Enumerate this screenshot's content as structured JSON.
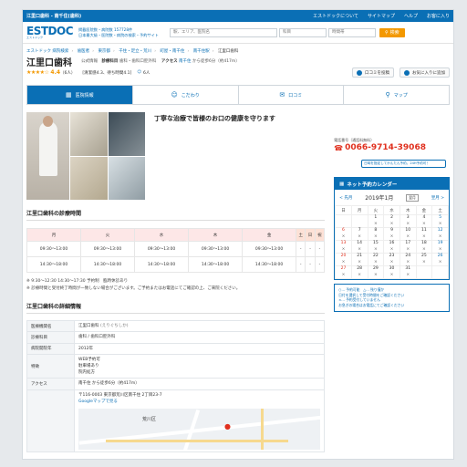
{
  "topbar": {
    "title": "江里口歯科 - 南千住(歯科)",
    "links": [
      "エストドックについて",
      "サイトマップ",
      "ヘルプ",
      "お客に入り"
    ]
  },
  "header": {
    "logo": "ESTDOC",
    "logo_sub": "エストドック",
    "tagline1": "掲載医院数・病院数 157728件",
    "tagline2": "日本最大級・医院数・病院の検索・予約サイト",
    "search_placeholder": "駅、エリア、医院名",
    "search_dept": "科目",
    "search_time": "時間帯",
    "search_button": "検索"
  },
  "breadcrumbs": [
    "エストドック 病院検索",
    "歯医者",
    "東京都",
    "千住・足立・荒川",
    "町屋・南千住",
    "南千住駅",
    "江里口歯科"
  ],
  "clinic": {
    "name": "江里口歯科",
    "info_label": "公式情報",
    "dept_label": "診療科目",
    "depts": "歯科・歯科口腔外科",
    "access_label": "アクセス",
    "access": "南千住",
    "access_walk": "から徒歩6分（約417m）",
    "rating_stars": "★★★★☆",
    "rating": "4.4",
    "rating_count": "（6人）",
    "rating_detail": "[清潔感4.3、待ち時間4.1]",
    "likes": "6人",
    "btn_review": "口コミを投稿",
    "btn_fav": "お気に入りに追加"
  },
  "tabs": [
    {
      "label": "医院情報",
      "icon": "▦"
    },
    {
      "label": "こだわり",
      "icon": "☺"
    },
    {
      "label": "口コミ",
      "icon": "✉"
    },
    {
      "label": "マップ",
      "icon": "⚲"
    }
  ],
  "catch": "丁寧な治療で皆様のお口の健康を守ります",
  "hours": {
    "heading": "江里口歯科の診療時間",
    "days": [
      "月",
      "火",
      "水",
      "木",
      "金",
      "土",
      "日",
      "祝"
    ],
    "rows": [
      [
        "09:30〜13:00",
        "09:30〜13:00",
        "09:30〜13:00",
        "09:30〜13:00",
        "09:30〜13:00",
        "-",
        "-",
        "-"
      ],
      [
        "14:30〜18:00",
        "14:30〜18:00",
        "14:30〜18:00",
        "14:30〜18:00",
        "14:30〜18:00",
        "-",
        "-",
        "-"
      ]
    ],
    "note1": "※ 9:30〜12:30 14:30〜17:30 予約制　臨時休診あり",
    "note2": "※ 診療時間と受付終了時間が一致しない場合がございます。ご予約またはお電話にてご確認の上、ご来院ください。"
  },
  "detail": {
    "heading": "江里口歯科の詳細情報",
    "rows": [
      {
        "k": "医療機関名",
        "v": "江里口歯科",
        "sub": "(えりぐちしか)"
      },
      {
        "k": "診療科目",
        "v": "歯科 / 歯科口腔外科",
        "sub": ""
      },
      {
        "k": "病院開院年",
        "v": "2012年",
        "sub": ""
      },
      {
        "k": "特徴",
        "v": "WEB予約可\n駐車場あり\n院内処方",
        "sub": ""
      },
      {
        "k": "アクセス",
        "v": "南千住 から徒歩6分（約417m）",
        "sub": ""
      }
    ],
    "address": "〒116-0003 東京都荒川区南千住 2丁目23-7",
    "map_link": "Googleマップで見る",
    "map_label": "荒川区"
  },
  "sidebar": {
    "phone_label": "電話番号（通話料無料）",
    "phone": "0066-9714-39068",
    "cal_note": "日時を指定してかんたん予約。24H予約可！",
    "cal_title": "ネット予約カレンダー",
    "prev": "< 先月",
    "month": "2019年1月",
    "next": "翌月 >",
    "month_select": "翌月",
    "weekdays": [
      "日",
      "月",
      "火",
      "水",
      "木",
      "金",
      "土"
    ],
    "weeks": [
      [
        [
          "",
          ""
        ],
        [
          "",
          ""
        ],
        [
          "1",
          "×"
        ],
        [
          "2",
          "×"
        ],
        [
          "3",
          "×"
        ],
        [
          "4",
          "×"
        ],
        [
          "5",
          "×"
        ]
      ],
      [
        [
          "6",
          "×"
        ],
        [
          "7",
          "×"
        ],
        [
          "8",
          "×"
        ],
        [
          "9",
          "×"
        ],
        [
          "10",
          "×"
        ],
        [
          "11",
          "×"
        ],
        [
          "12",
          "×"
        ]
      ],
      [
        [
          "13",
          "×"
        ],
        [
          "14",
          "×"
        ],
        [
          "15",
          "×"
        ],
        [
          "16",
          "×"
        ],
        [
          "17",
          "×"
        ],
        [
          "18",
          "×"
        ],
        [
          "19",
          "×"
        ]
      ],
      [
        [
          "20",
          "×"
        ],
        [
          "21",
          "×"
        ],
        [
          "22",
          "×"
        ],
        [
          "23",
          "×"
        ],
        [
          "24",
          "×"
        ],
        [
          "25",
          "×"
        ],
        [
          "26",
          "×"
        ]
      ],
      [
        [
          "27",
          "×"
        ],
        [
          "28",
          "×"
        ],
        [
          "29",
          "×"
        ],
        [
          "30",
          "×"
        ],
        [
          "31",
          "×"
        ],
        [
          "",
          ""
        ],
        [
          "",
          ""
        ]
      ]
    ],
    "cal_foot1": "○... 予約可能　△... 残り僅か",
    "cal_foot2": "日付を選択して受付時間をご確認ください",
    "cal_foot3": "×... 予約受付していません",
    "cal_foot4": "お急ぎの場合はお電話にてご確認ください"
  }
}
